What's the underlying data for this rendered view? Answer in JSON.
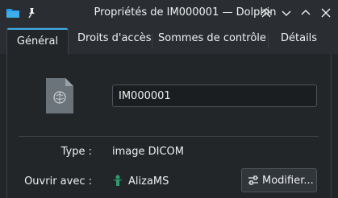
{
  "window": {
    "title": "Propriétés de IM000001 — Dolphin",
    "app_icon": "folder-icon",
    "controls": [
      "keep-above-icon",
      "keep-below-icon",
      "minimize-icon",
      "maximize-icon",
      "close-icon"
    ]
  },
  "tabs": [
    {
      "label": "Général",
      "active": true
    },
    {
      "label": "Droits d'accès",
      "active": false
    },
    {
      "label": "Sommes de contrôle",
      "active": false
    },
    {
      "label": "Détails",
      "active": false
    }
  ],
  "general": {
    "file_icon": "dicom-file-icon",
    "name_value": "IM000001",
    "type_label": "Type :",
    "type_value": "image DICOM",
    "open_with_label": "Ouvrir avec :",
    "open_with_app": "AlizaMS",
    "open_with_app_icon": "alizams-icon",
    "modify_label": "Modifier...",
    "modify_icon": "configure-icon"
  },
  "colors": {
    "window_bg": "#232629",
    "titlebar_bg": "#2a2e32",
    "accent": "#3daee9",
    "text": "#eff0f1",
    "border": "#3b4045"
  }
}
